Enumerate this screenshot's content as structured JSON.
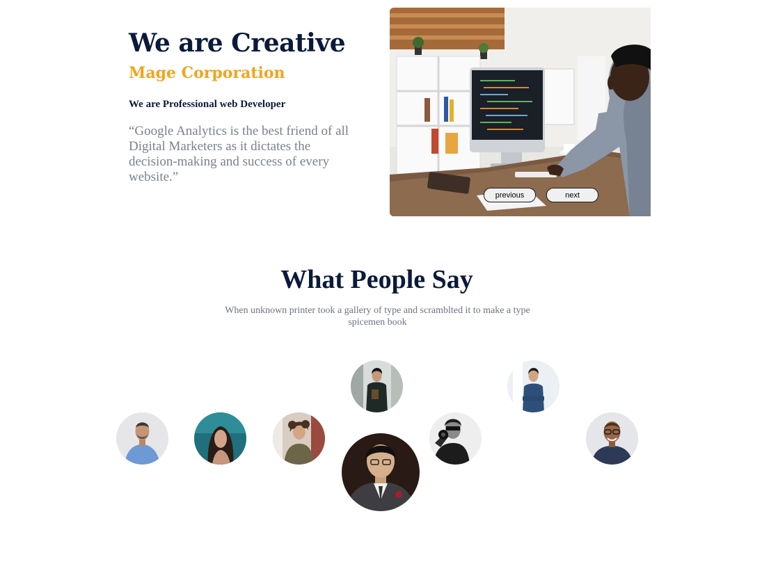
{
  "hero": {
    "title": "We are Creative",
    "subtitle": "Mage Corporation",
    "tagline": "We are Professional web Developer",
    "quote": "“Google Analytics is the best friend of all Digital Marketers as it dictates the decision-making and success of every website.”",
    "slider": {
      "previous_label": "previous",
      "next_label": "next"
    },
    "accent_color": "#f4a31c",
    "heading_color": "#0b1a3a"
  },
  "testimonials": {
    "title": "What People Say",
    "description": "When unknown printer took a gallery of type and scramblted it to make a type spicemen book",
    "avatars": [
      {
        "name": "avatar-man-blue-shirt",
        "active": false
      },
      {
        "name": "avatar-woman-teal",
        "active": false
      },
      {
        "name": "avatar-woman-curly",
        "active": false
      },
      {
        "name": "avatar-man-black-jacket",
        "active": false
      },
      {
        "name": "avatar-man-suit",
        "active": true
      },
      {
        "name": "avatar-man-bw",
        "active": false
      },
      {
        "name": "avatar-man-blue-sweater",
        "active": false
      },
      {
        "name": "avatar-man-glasses",
        "active": false
      }
    ]
  }
}
